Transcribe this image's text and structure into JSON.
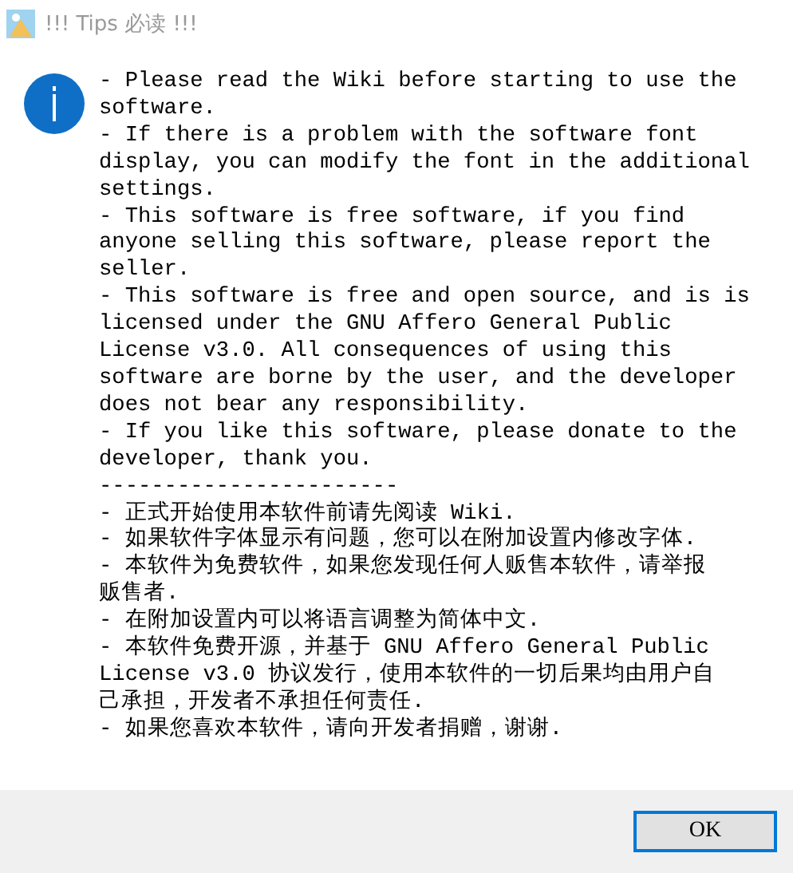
{
  "window": {
    "title": "!!! Tips 必读 !!!"
  },
  "message": {
    "lines": [
      "- Please read the Wiki before starting to use the",
      "software.",
      "- If there is a problem with the software font",
      "display, you can modify the font in the additional",
      "settings.",
      "- This software is free software, if you find",
      "anyone selling this software, please report the",
      "seller.",
      "- This software is free and open source, and is is",
      "licensed under the GNU Affero General Public",
      "License v3.0. All consequences of using this",
      "software are borne by the user, and the developer",
      "does not bear any responsibility.",
      "- If you like this software, please donate to the",
      "developer, thank you.",
      "-----------------------",
      "- 正式开始使用本软件前请先阅读 Wiki.",
      "- 如果软件字体显示有问题，您可以在附加设置内修改字体.",
      "- 本软件为免费软件，如果您发现任何人贩售本软件，请举报",
      "贩售者.",
      "- 在附加设置内可以将语言调整为简体中文.",
      "- 本软件免费开源，并基于 GNU Affero General Public",
      "License v3.0 协议发行，使用本软件的一切后果均由用户自",
      "己承担，开发者不承担任何责任.",
      "- 如果您喜欢本软件，请向开发者捐赠，谢谢."
    ]
  },
  "buttons": [
    {
      "label": "OK",
      "selected": true
    }
  ]
}
